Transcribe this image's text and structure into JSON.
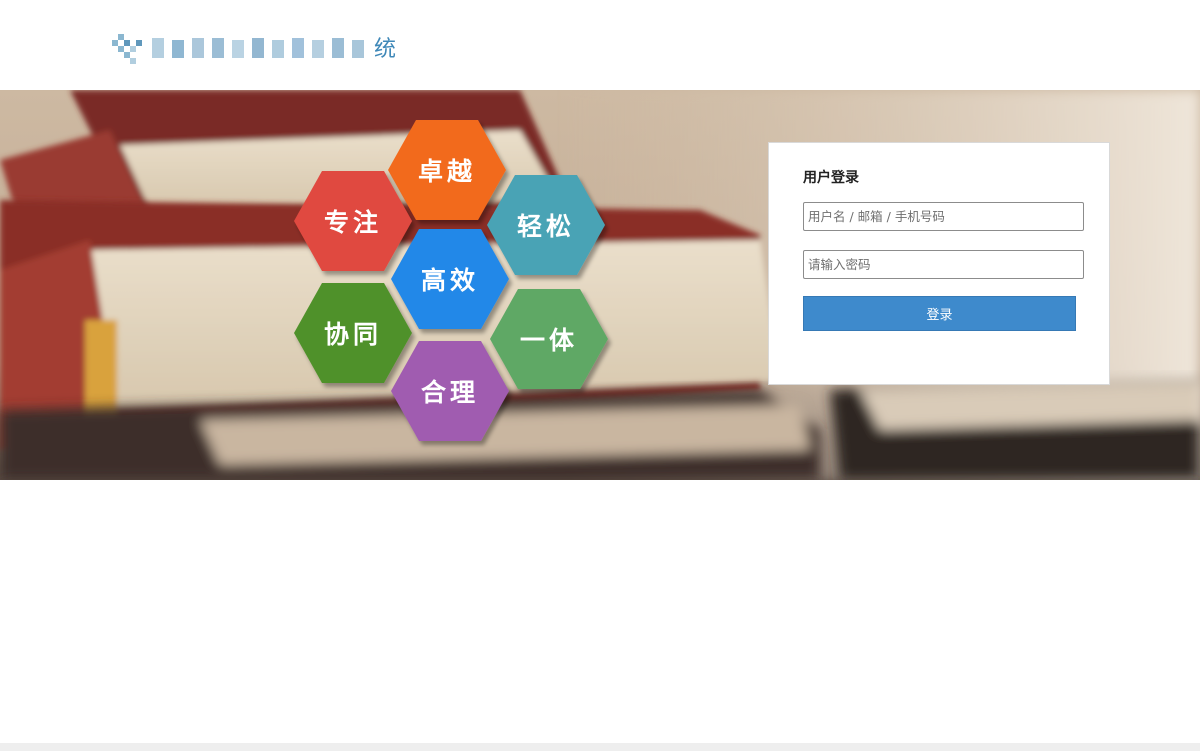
{
  "header": {
    "logo_text": "高 速 服 务 区 管 理 系 统",
    "logo_last_char": "统"
  },
  "banner": {
    "hexagons": [
      {
        "label": "卓越",
        "color": "#f26b1d",
        "icon": "hex-tile"
      },
      {
        "label": "专注",
        "color": "#e04a3f",
        "icon": "hex-tile"
      },
      {
        "label": "轻松",
        "color": "#4aa3b5",
        "icon": "hex-tile"
      },
      {
        "label": "高效",
        "color": "#2388e8",
        "icon": "hex-tile"
      },
      {
        "label": "协同",
        "color": "#4f9129",
        "icon": "hex-tile"
      },
      {
        "label": "一体",
        "color": "#5ea865",
        "icon": "hex-tile"
      },
      {
        "label": "合理",
        "color": "#a05cb0",
        "icon": "hex-tile"
      }
    ]
  },
  "login": {
    "title": "用户登录",
    "username_placeholder": "用户名 / 邮箱 / 手机号码",
    "username_value": "",
    "password_placeholder": "请输入密码",
    "password_value": "",
    "submit_label": "登录",
    "accent_color": "#3e8acc"
  }
}
